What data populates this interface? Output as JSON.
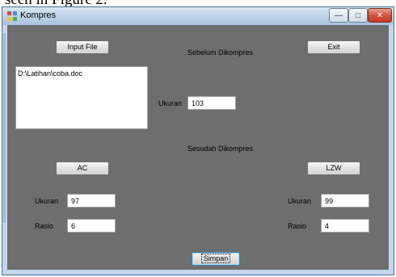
{
  "page_caption": "seen in Figure 2.",
  "window": {
    "title": "Kompres",
    "controls": {
      "minimize": "—",
      "maximize": "□",
      "close": "✕"
    }
  },
  "buttons": {
    "input_file": "Input File",
    "exit": "Exit",
    "ac": "AC",
    "lzw": "LZW",
    "simpan": "Simpan"
  },
  "file_path": "D:\\Latihan\\coba.doc",
  "before": {
    "heading": "Sebelum Dikompres",
    "size_label": "Ukuran",
    "size_value": "103"
  },
  "after_heading": "Sesudah Dikompres",
  "ac_result": {
    "size_label": "Ukuran",
    "size_value": "97",
    "ratio_label": "Rasio",
    "ratio_value": "6"
  },
  "lzw_result": {
    "size_label": "Ukuran",
    "size_value": "99",
    "ratio_label": "Rasio",
    "ratio_value": "4"
  },
  "colors": {
    "client_background": "#6e6e6e",
    "titlebar": "#c0d5ea",
    "close_button": "#c4392a"
  }
}
